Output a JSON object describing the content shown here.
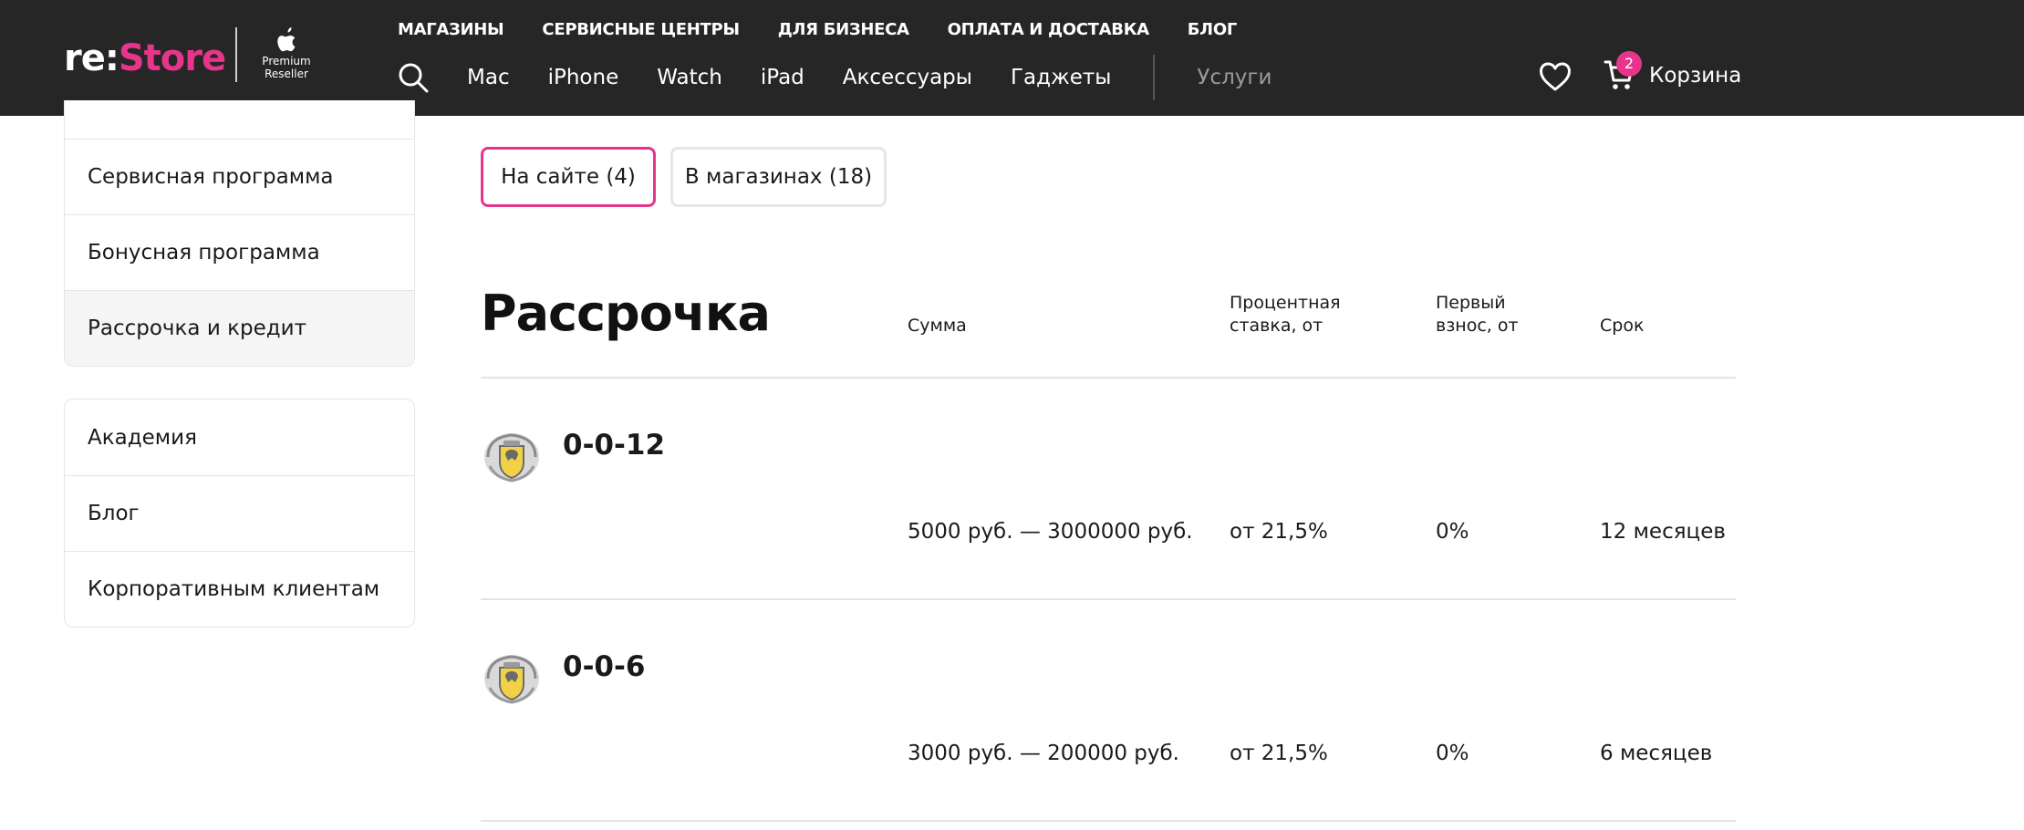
{
  "header": {
    "logo": {
      "prefix": "re:",
      "name": "Store"
    },
    "reseller": {
      "line1": "Premium",
      "line2": "Reseller"
    },
    "top_nav": [
      "МАГАЗИНЫ",
      "СЕРВИСНЫЕ ЦЕНТРЫ",
      "ДЛЯ БИЗНЕСА",
      "ОПЛАТА И ДОСТАВКА",
      "БЛОГ"
    ],
    "main_nav": [
      "Mac",
      "iPhone",
      "Watch",
      "iPad",
      "Аксессуары",
      "Гаджеты"
    ],
    "services_label": "Услуги",
    "cart": {
      "count": "2",
      "label": "Корзина"
    }
  },
  "sidebar": {
    "group1": [
      "Сервисная программа",
      "Бонусная программа",
      "Рассрочка и кредит"
    ],
    "group2": [
      "Академия",
      "Блог",
      "Корпоративным клиентам"
    ]
  },
  "tabs": {
    "on_site": "На сайте (4)",
    "in_stores": "В магазинах (18)"
  },
  "section": {
    "title": "Рассрочка",
    "columns": {
      "sum": "Сумма",
      "rate_line1": "Процентная",
      "rate_line2": "ставка, от",
      "first_line1": "Первый",
      "first_line2": "взнос, от",
      "term": "Срок"
    }
  },
  "offers": [
    {
      "name": "0-0-12",
      "sum": "5000 руб. — 3000000 руб.",
      "rate": "от 21,5%",
      "first": "0%",
      "term": "12 месяцев"
    },
    {
      "name": "0-0-6",
      "sum": "3000 руб. — 200000 руб.",
      "rate": "от 21,5%",
      "first": "0%",
      "term": "6 месяцев"
    }
  ],
  "colors": {
    "accent": "#e8358c",
    "header_bg": "#262626"
  }
}
